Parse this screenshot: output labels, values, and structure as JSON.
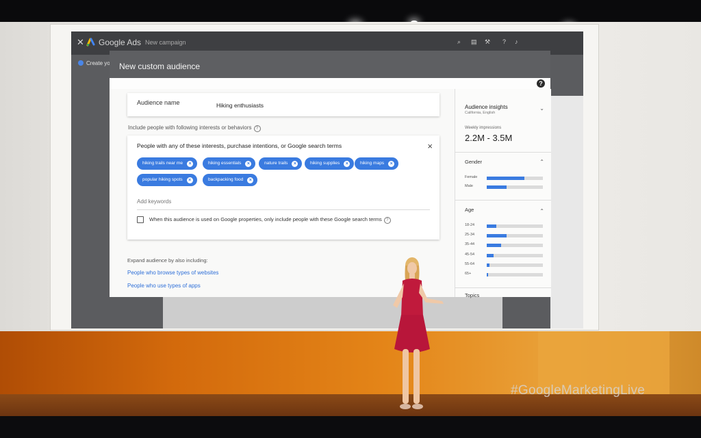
{
  "app": {
    "brand": "Google Ads",
    "crumb": "New campaign",
    "create_label": "Create you"
  },
  "dialog": {
    "title": "New custom audience",
    "audience_name_label": "Audience name",
    "audience_name_value": "Hiking enthusiasts",
    "include_label": "Include people with following interests or behaviors",
    "interests_heading": "People with any of these interests, purchase intentions, or Google search terms",
    "chips": [
      "hiking trails near me",
      "hiking essentials",
      "nature trails",
      "hiking supplies",
      "hiking maps",
      "popular hiking spots",
      "backpacking food"
    ],
    "add_keywords_placeholder": "Add keywords",
    "checkbox_label": "When this audience is used on Google properties, only include people with these Google search terms",
    "checkbox_checked": false,
    "expand_label": "Expand audience by also including:",
    "links": [
      "People who browse types of websites",
      "People who use types of apps"
    ]
  },
  "insights": {
    "title": "Audience insights",
    "subtitle": "California, English",
    "weekly_label": "Weekly impressions",
    "weekly_value": "2.2M - 3.5M",
    "gender_title": "Gender",
    "gender": [
      {
        "label": "Female",
        "value": 0.67
      },
      {
        "label": "Male",
        "value": 0.35
      }
    ],
    "age_title": "Age",
    "age": [
      {
        "label": "18-24",
        "value": 0.17
      },
      {
        "label": "25-34",
        "value": 0.35
      },
      {
        "label": "35-44",
        "value": 0.26
      },
      {
        "label": "45-54",
        "value": 0.12
      },
      {
        "label": "55-64",
        "value": 0.05
      },
      {
        "label": "65+",
        "value": 0.02
      }
    ],
    "topics_title": "Topics"
  },
  "event": {
    "hashtag": "#GoogleMarketingLive"
  },
  "colors": {
    "accent": "#3a7be0",
    "stage_orange": "#e48518"
  }
}
